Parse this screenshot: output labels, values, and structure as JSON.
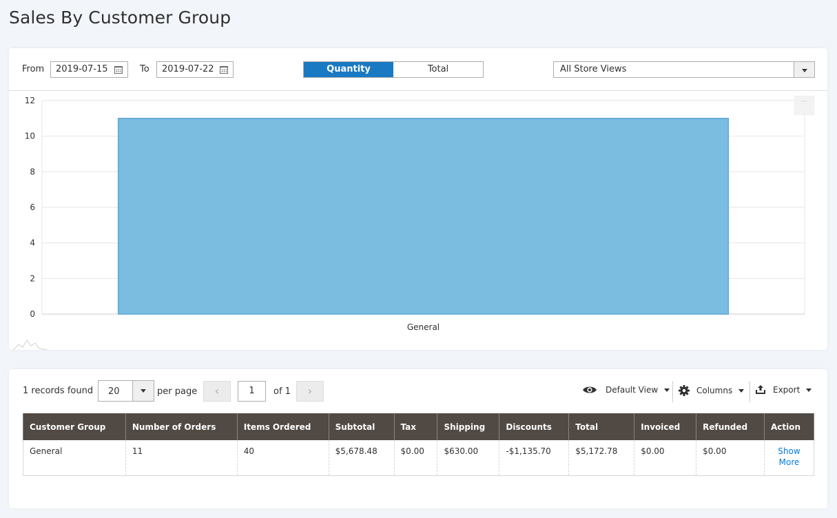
{
  "page": {
    "title": "Sales By Customer Group"
  },
  "filters": {
    "from_label": "From",
    "from_value": "2019-07-15",
    "to_label": "To",
    "to_value": "2019-07-22",
    "toggle": [
      "Quantity",
      "Total"
    ],
    "toggle_active": "Quantity",
    "store_view": "All Store Views"
  },
  "chart_data": {
    "type": "bar",
    "categories": [
      "General"
    ],
    "values": [
      11
    ],
    "ylim": [
      0,
      12
    ],
    "yticks": [
      0,
      2,
      4,
      6,
      8,
      10,
      12
    ],
    "grid": true,
    "bar_color": "#7bbde0",
    "bar_border": "#5aa8d6"
  },
  "grid": {
    "records_found": "1 records found",
    "per_page_value": "20",
    "per_page_label": "per page",
    "page_value": "1",
    "page_of": "of 1",
    "prev_glyph": "‹",
    "next_glyph": "›",
    "view_label": "Default View",
    "columns_label": "Columns",
    "export_label": "Export",
    "headers": [
      "Customer Group",
      "Number of Orders",
      "Items Ordered",
      "Subtotal",
      "Tax",
      "Shipping",
      "Discounts",
      "Total",
      "Invoiced",
      "Refunded",
      "Action"
    ],
    "rows": [
      [
        "General",
        "11",
        "40",
        "$5,678.48",
        "$0.00",
        "$630.00",
        "-$1,135.70",
        "$5,172.78",
        "$0.00",
        "$0.00",
        "Show More"
      ]
    ]
  },
  "colors": {
    "accent": "#1979c3",
    "header_bg": "#514943",
    "link": "#007bdb"
  }
}
